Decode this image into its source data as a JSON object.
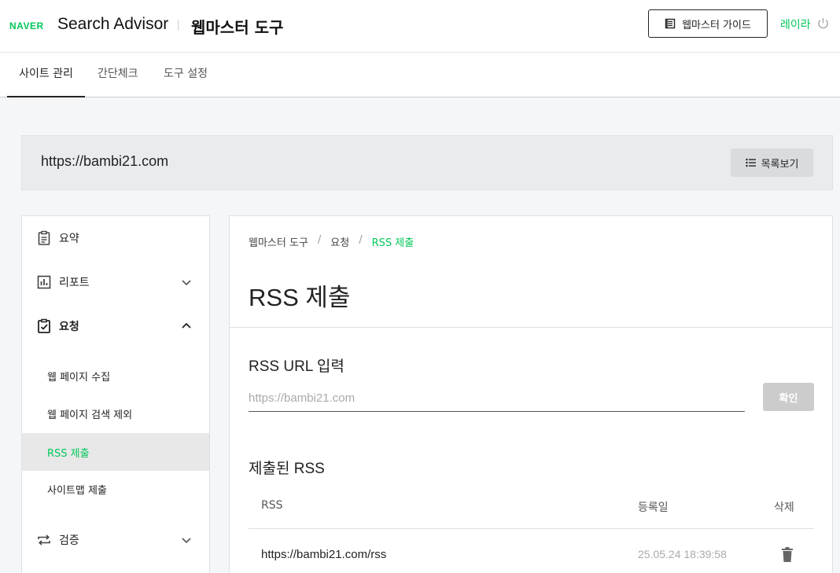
{
  "header": {
    "logo": "NAVER",
    "brand": "Search Advisor",
    "tool_title": "웹마스터 도구",
    "guide_label": "웹마스터 가이드",
    "user_name": "레이라"
  },
  "tabs": [
    {
      "label": "사이트 관리",
      "active": true
    },
    {
      "label": "간단체크",
      "active": false
    },
    {
      "label": "도구 설정",
      "active": false
    }
  ],
  "site": {
    "url": "https://bambi21.com",
    "list_button": "목록보기"
  },
  "sidebar": {
    "items": [
      {
        "label": "요약",
        "icon": "clipboard-icon"
      },
      {
        "label": "리포트",
        "icon": "bar-chart-icon"
      },
      {
        "label": "요청",
        "icon": "clipboard-check-icon"
      },
      {
        "label": "검증",
        "icon": "repeat-icon"
      }
    ],
    "sub_items": [
      {
        "label": "웹 페이지 수집"
      },
      {
        "label": "웹 페이지 검색 제외"
      },
      {
        "label": "RSS 제출"
      },
      {
        "label": "사이트맵 제출"
      }
    ]
  },
  "content": {
    "breadcrumb": [
      "웹마스터 도구",
      "요청",
      "RSS 제출"
    ],
    "title": "RSS 제출",
    "input_section": "RSS URL 입력",
    "input_placeholder": "https://bambi21.com",
    "confirm_label": "확인",
    "list_section": "제출된 RSS",
    "table": {
      "headers": [
        "RSS",
        "등록일",
        "삭제"
      ],
      "rows": [
        {
          "url": "https://bambi21.com/rss",
          "date": "25.05.24 18:39:58"
        }
      ]
    }
  },
  "colors": {
    "accent": "#03c75a",
    "selected_bg": "#e8e8e8",
    "site_bar_bg": "#e9ecef"
  }
}
